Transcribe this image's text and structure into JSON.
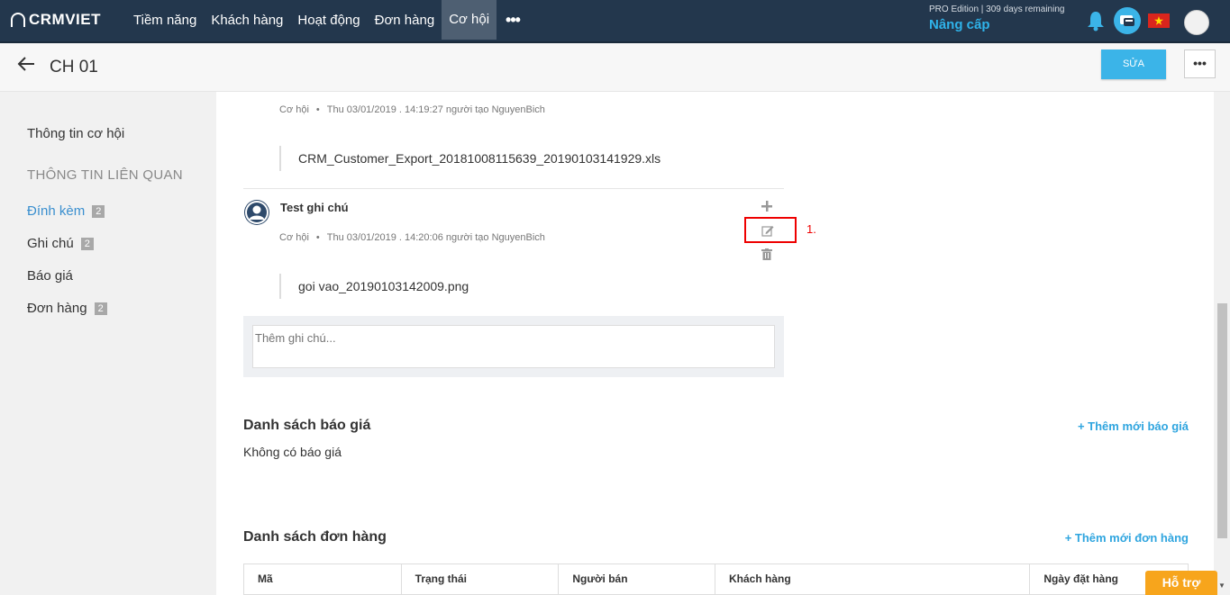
{
  "app": {
    "logo": "CRMVIET",
    "nav": [
      "Tiềm năng",
      "Khách hàng",
      "Hoạt động",
      "Đơn hàng",
      "Cơ hội"
    ],
    "nav_active": "Cơ hội",
    "more": "•••",
    "edition": "PRO Edition | 309 days remaining",
    "upgrade": "Nâng cấp"
  },
  "header": {
    "title": "CH 01",
    "edit_label": "SỬA",
    "more_label": "•••"
  },
  "sidebar": {
    "info": "Thông tin cơ hội",
    "related_heading": "THÔNG TIN LIÊN QUAN",
    "items": [
      {
        "label": "Đính kèm",
        "badge": "2"
      },
      {
        "label": "Ghi chú",
        "badge": "2"
      },
      {
        "label": "Báo giá",
        "badge": ""
      },
      {
        "label": "Đơn hàng",
        "badge": "2"
      }
    ]
  },
  "notes": [
    {
      "type": "Cơ hội",
      "date": "Thu 03/01/2019 . 14:19:27",
      "creator_label": "người tạo",
      "creator": "NguyenBich",
      "file": "CRM_Customer_Export_20181008115639_20190103141929.xls"
    },
    {
      "title": "Test ghi chú",
      "type": "Cơ hội",
      "date": "Thu 03/01/2019 . 14:20:06",
      "creator_label": "người tạo",
      "creator": "NguyenBich",
      "file": "goi vao_20190103142009.png"
    }
  ],
  "annotation": "1.",
  "note_input": {
    "placeholder": "Thêm ghi chú..."
  },
  "quotes": {
    "title": "Danh sách báo giá",
    "add": "+ Thêm mới báo giá",
    "empty": "Không có báo giá"
  },
  "orders": {
    "title": "Danh sách đơn hàng",
    "add": "+ Thêm mới đơn hàng",
    "columns": [
      "Mã",
      "Trạng thái",
      "Người bán",
      "Khách hàng",
      "Ngày đặt hàng"
    ]
  },
  "support": "Hỗ trợ",
  "colors": {
    "topbar": "#23374d",
    "accent": "#3bb4e8",
    "support": "#f7a51c",
    "highlight": "#e00000"
  }
}
